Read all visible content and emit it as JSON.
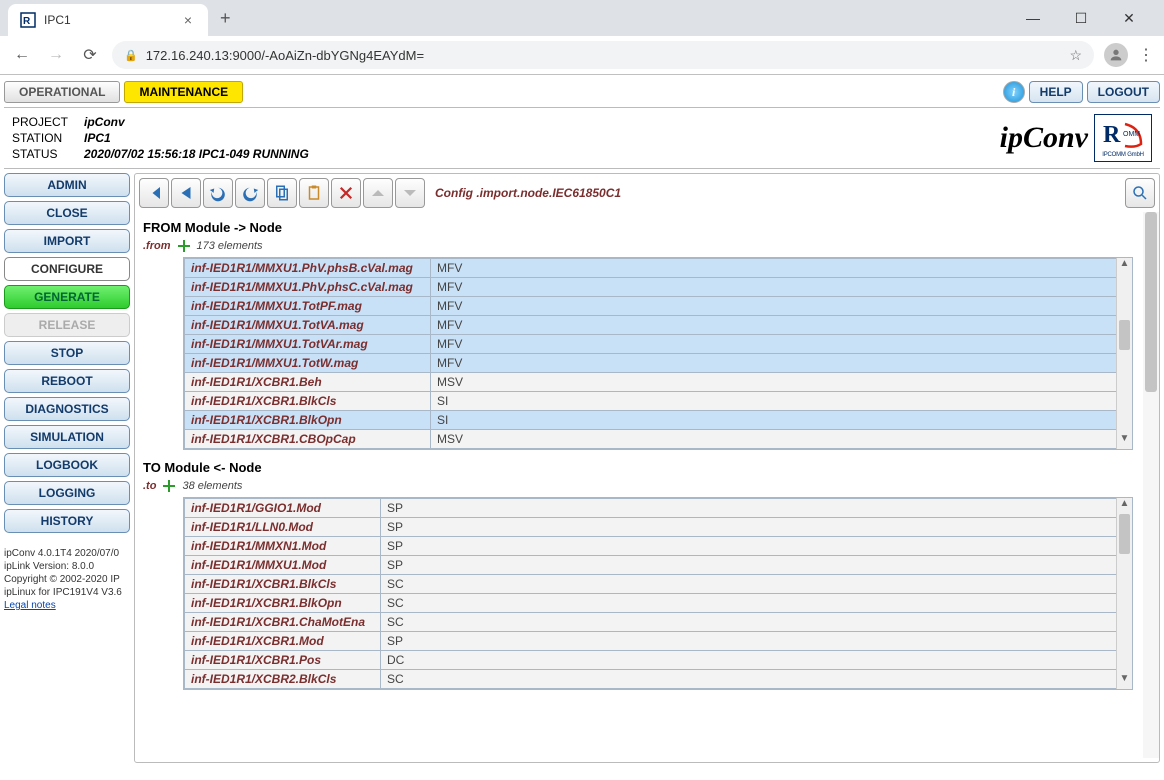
{
  "browser": {
    "tab_title": "IPC1",
    "url": "172.16.240.13:9000/-AoAiZn-dbYGNg4EAYdM="
  },
  "topbar": {
    "operational": "OPERATIONAL",
    "maintenance": "MAINTENANCE",
    "help": "HELP",
    "logout": "LOGOUT"
  },
  "header": {
    "project_lbl": "PROJECT",
    "project_val": "ipConv",
    "station_lbl": "STATION",
    "station_val": "IPC1",
    "status_lbl": "STATUS",
    "status_val": "2020/07/02 15:56:18 IPC1-049 RUNNING",
    "brand": "ipConv",
    "logo_sub": "IPCOMM GmbH"
  },
  "sidebar": {
    "buttons": [
      {
        "label": "ADMIN",
        "style": "blue"
      },
      {
        "label": "CLOSE",
        "style": "blue"
      },
      {
        "label": "IMPORT",
        "style": "blue"
      },
      {
        "label": "CONFIGURE",
        "style": "plain"
      },
      {
        "label": "GENERATE",
        "style": "green"
      },
      {
        "label": "RELEASE",
        "style": "disabled"
      },
      {
        "label": "STOP",
        "style": "blue"
      },
      {
        "label": "REBOOT",
        "style": "blue"
      },
      {
        "label": "DIAGNOSTICS",
        "style": "blue"
      },
      {
        "label": "SIMULATION",
        "style": "blue"
      },
      {
        "label": "LOGBOOK",
        "style": "blue"
      },
      {
        "label": "LOGGING",
        "style": "blue"
      },
      {
        "label": "HISTORY",
        "style": "blue"
      }
    ],
    "footer": {
      "line1": "ipConv 4.0.1T4 2020/07/0",
      "line2": "ipLink Version: 8.0.0",
      "line3": "Copyright © 2002-2020 IP",
      "line4": "ipLinux for IPC191V4 V3.6",
      "legal": "Legal notes"
    }
  },
  "breadcrumb": "Config .import.node.IEC61850C1",
  "from_section": {
    "title": "FROM Module -> Node",
    "key": ".from",
    "count": "173 elements",
    "rows": [
      {
        "name": "inf-IED1R1/MMXU1.PhV.phsB.cVal.mag",
        "type": "MFV",
        "hl": true
      },
      {
        "name": "inf-IED1R1/MMXU1.PhV.phsC.cVal.mag",
        "type": "MFV",
        "hl": true
      },
      {
        "name": "inf-IED1R1/MMXU1.TotPF.mag",
        "type": "MFV",
        "hl": true
      },
      {
        "name": "inf-IED1R1/MMXU1.TotVA.mag",
        "type": "MFV",
        "hl": true
      },
      {
        "name": "inf-IED1R1/MMXU1.TotVAr.mag",
        "type": "MFV",
        "hl": true
      },
      {
        "name": "inf-IED1R1/MMXU1.TotW.mag",
        "type": "MFV",
        "hl": true
      },
      {
        "name": "inf-IED1R1/XCBR1.Beh",
        "type": "MSV",
        "hl": false
      },
      {
        "name": "inf-IED1R1/XCBR1.BlkCls",
        "type": "SI",
        "hl": false
      },
      {
        "name": "inf-IED1R1/XCBR1.BlkOpn",
        "type": "SI",
        "hl": true
      },
      {
        "name": "inf-IED1R1/XCBR1.CBOpCap",
        "type": "MSV",
        "hl": false
      }
    ]
  },
  "to_section": {
    "title": "TO Module <- Node",
    "key": ".to",
    "count": "38 elements",
    "rows": [
      {
        "name": "inf-IED1R1/GGIO1.Mod",
        "type": "SP"
      },
      {
        "name": "inf-IED1R1/LLN0.Mod",
        "type": "SP"
      },
      {
        "name": "inf-IED1R1/MMXN1.Mod",
        "type": "SP"
      },
      {
        "name": "inf-IED1R1/MMXU1.Mod",
        "type": "SP"
      },
      {
        "name": "inf-IED1R1/XCBR1.BlkCls",
        "type": "SC"
      },
      {
        "name": "inf-IED1R1/XCBR1.BlkOpn",
        "type": "SC"
      },
      {
        "name": "inf-IED1R1/XCBR1.ChaMotEna",
        "type": "SC"
      },
      {
        "name": "inf-IED1R1/XCBR1.Mod",
        "type": "SP"
      },
      {
        "name": "inf-IED1R1/XCBR1.Pos",
        "type": "DC"
      },
      {
        "name": "inf-IED1R1/XCBR2.BlkCls",
        "type": "SC"
      }
    ]
  }
}
